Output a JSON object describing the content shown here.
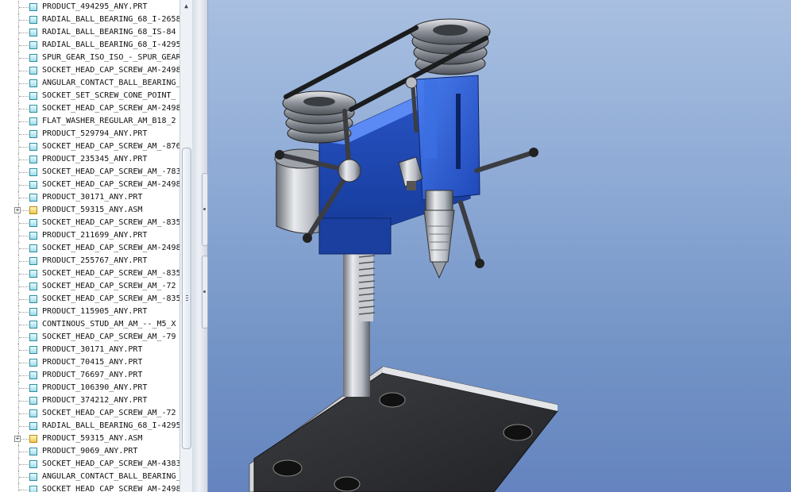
{
  "model_tree": {
    "items": [
      {
        "label": "PRODUCT_494295_ANY.PRT",
        "type": "part"
      },
      {
        "label": "RADIAL_BALL_BEARING_68_I-2658",
        "type": "part"
      },
      {
        "label": "RADIAL_BALL_BEARING_68_IS-84",
        "type": "part"
      },
      {
        "label": "RADIAL_BALL_BEARING_68_I-4295",
        "type": "part"
      },
      {
        "label": "SPUR_GEAR_ISO_ISO_-_SPUR_GEAR",
        "type": "part"
      },
      {
        "label": "SOCKET_HEAD_CAP_SCREW_AM-2498",
        "type": "part"
      },
      {
        "label": "ANGULAR_CONTACT_BALL_BEARING_",
        "type": "part"
      },
      {
        "label": "SOCKET_SET_SCREW_CONE_POINT_",
        "type": "part"
      },
      {
        "label": "SOCKET_HEAD_CAP_SCREW_AM-2498",
        "type": "part"
      },
      {
        "label": "FLAT_WASHER_REGULAR_AM_B18_2",
        "type": "part"
      },
      {
        "label": "PRODUCT_529794_ANY.PRT",
        "type": "part"
      },
      {
        "label": "SOCKET_HEAD_CAP_SCREW_AM_-876",
        "type": "part"
      },
      {
        "label": "PRODUCT_235345_ANY.PRT",
        "type": "part"
      },
      {
        "label": "SOCKET_HEAD_CAP_SCREW_AM_-783",
        "type": "part"
      },
      {
        "label": "SOCKET_HEAD_CAP_SCREW_AM-2498",
        "type": "part"
      },
      {
        "label": "PRODUCT_30171_ANY.PRT",
        "type": "part"
      },
      {
        "label": "PRODUCT_59315_ANY.ASM",
        "type": "assembly",
        "expandable": true
      },
      {
        "label": "SOCKET_HEAD_CAP_SCREW_AM_-835",
        "type": "part"
      },
      {
        "label": "PRODUCT_211699_ANY.PRT",
        "type": "part"
      },
      {
        "label": "SOCKET_HEAD_CAP_SCREW_AM-2498",
        "type": "part"
      },
      {
        "label": "PRODUCT_255767_ANY.PRT",
        "type": "part"
      },
      {
        "label": "SOCKET_HEAD_CAP_SCREW_AM_-835",
        "type": "part"
      },
      {
        "label": "SOCKET_HEAD_CAP_SCREW_AM_-72",
        "type": "part"
      },
      {
        "label": "SOCKET_HEAD_CAP_SCREW_AM_-835",
        "type": "part"
      },
      {
        "label": "PRODUCT_115905_ANY.PRT",
        "type": "part"
      },
      {
        "label": "CONTINOUS_STUD_AM_AM_--_M5_X",
        "type": "part"
      },
      {
        "label": "SOCKET_HEAD_CAP_SCREW_AM_-79",
        "type": "part"
      },
      {
        "label": "PRODUCT_30171_ANY.PRT",
        "type": "part"
      },
      {
        "label": "PRODUCT_70415_ANY.PRT",
        "type": "part"
      },
      {
        "label": "PRODUCT_76697_ANY.PRT",
        "type": "part"
      },
      {
        "label": "PRODUCT_106390_ANY.PRT",
        "type": "part"
      },
      {
        "label": "PRODUCT_374212_ANY.PRT",
        "type": "part"
      },
      {
        "label": "SOCKET_HEAD_CAP_SCREW_AM_-72",
        "type": "part"
      },
      {
        "label": "RADIAL_BALL_BEARING_68_I-4295",
        "type": "part"
      },
      {
        "label": "PRODUCT_59315_ANY.ASM",
        "type": "assembly",
        "expandable": true
      },
      {
        "label": "PRODUCT_9069_ANY.PRT",
        "type": "part"
      },
      {
        "label": "SOCKET_HEAD_CAP_SCREW_AM-4383",
        "type": "part"
      },
      {
        "label": "ANGULAR_CONTACT_BALL_BEARING_",
        "type": "part"
      },
      {
        "label": "SOCKET_HEAD_CAP_SCREW_AM-2498",
        "type": "part"
      }
    ],
    "expand_glyph": "+"
  },
  "scrollbar": {
    "up_arrow": "▲"
  },
  "viewport": {
    "model": "drill-press",
    "colors": {
      "body": "#2f62d8",
      "metal": "#c4c7cc",
      "base": "#333538",
      "background_top": "#a8bfe0",
      "background_bottom": "#6584bf"
    }
  }
}
